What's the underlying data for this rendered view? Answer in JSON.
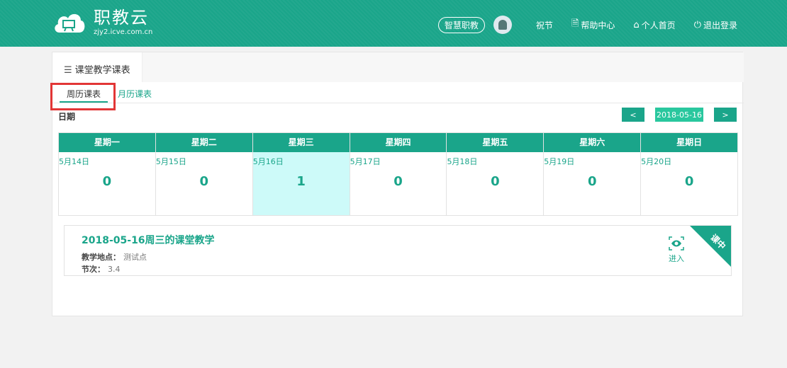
{
  "header": {
    "logo_title": "职教云",
    "logo_sub": "zjy2.icve.com.cn",
    "chip": "智慧职教",
    "user_name": "祝节",
    "help": "帮助中心",
    "home": "个人首页",
    "logout": "退出登录"
  },
  "section": {
    "title": "课堂教学课表"
  },
  "tabs": {
    "weekly": "周历课表",
    "monthly": "月历课表"
  },
  "date_label": "日期",
  "pager": {
    "prev": "<",
    "date": "2018-05-16",
    "next": ">"
  },
  "week": [
    {
      "name": "星期一",
      "date": "5月14日",
      "count": "0"
    },
    {
      "name": "星期二",
      "date": "5月15日",
      "count": "0"
    },
    {
      "name": "星期三",
      "date": "5月16日",
      "count": "1"
    },
    {
      "name": "星期四",
      "date": "5月17日",
      "count": "0"
    },
    {
      "name": "星期五",
      "date": "5月18日",
      "count": "0"
    },
    {
      "name": "星期六",
      "date": "5月19日",
      "count": "0"
    },
    {
      "name": "星期日",
      "date": "5月20日",
      "count": "0"
    }
  ],
  "lesson": {
    "title": "2018-05-16周三的课堂教学",
    "location_label": "教学地点：",
    "location": "测试点",
    "period_label": "节次：",
    "period": "3.4",
    "enter": "进入",
    "status": "课中"
  },
  "colors": {
    "brand": "#1aa58a",
    "today_bg": "#cdfaf9",
    "highlight": "#e23636"
  }
}
